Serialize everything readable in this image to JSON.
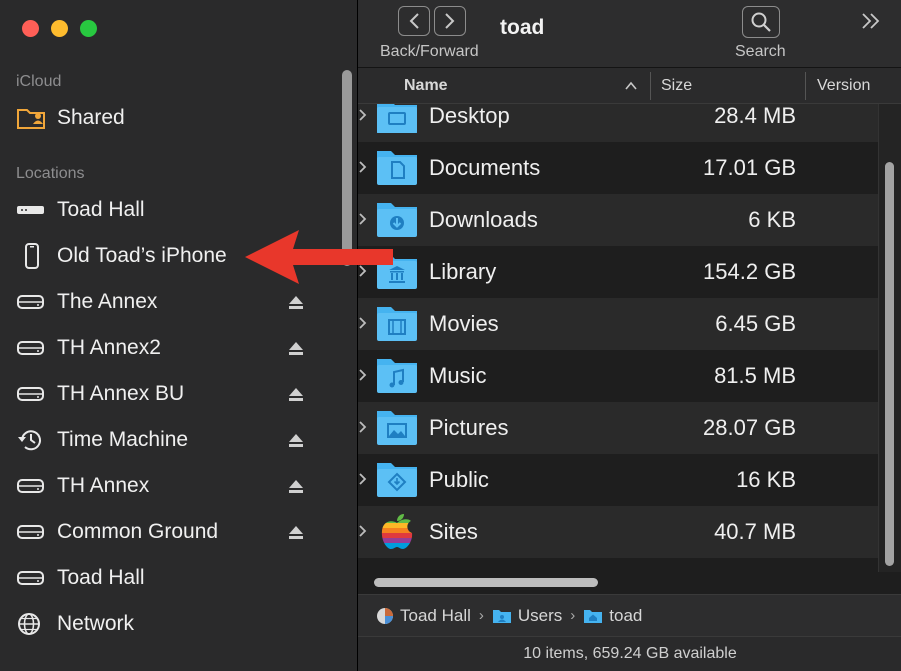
{
  "window": {
    "title": "toad"
  },
  "toolbar": {
    "back_forward_label": "Back/Forward",
    "search_label": "Search"
  },
  "sidebar": {
    "sections": [
      {
        "label": "iCloud",
        "items": [
          {
            "label": "Shared",
            "icon": "shared-folder-icon",
            "eject": false
          }
        ]
      },
      {
        "label": "Locations",
        "items": [
          {
            "label": "Toad Hall",
            "icon": "computer-icon",
            "eject": false
          },
          {
            "label": "Old Toad’s iPhone",
            "icon": "iphone-icon",
            "eject": false
          },
          {
            "label": "The Annex",
            "icon": "drive-icon",
            "eject": true
          },
          {
            "label": "TH Annex2",
            "icon": "drive-icon",
            "eject": true
          },
          {
            "label": "TH Annex BU",
            "icon": "drive-icon",
            "eject": true
          },
          {
            "label": "Time Machine",
            "icon": "time-machine-icon",
            "eject": true
          },
          {
            "label": "TH Annex",
            "icon": "drive-icon",
            "eject": true
          },
          {
            "label": "Common Ground",
            "icon": "drive-icon",
            "eject": true
          },
          {
            "label": "Toad Hall",
            "icon": "drive-icon",
            "eject": false
          },
          {
            "label": "Network",
            "icon": "network-globe-icon",
            "eject": false
          }
        ]
      }
    ]
  },
  "columns": {
    "name": "Name",
    "size": "Size",
    "version": "Version"
  },
  "files": [
    {
      "name": "Desktop",
      "size": "28.4 MB",
      "icon": "desktop-folder-icon"
    },
    {
      "name": "Documents",
      "size": "17.01 GB",
      "icon": "documents-folder-icon"
    },
    {
      "name": "Downloads",
      "size": "6 KB",
      "icon": "downloads-folder-icon"
    },
    {
      "name": "Library",
      "size": "154.2 GB",
      "icon": "library-folder-icon"
    },
    {
      "name": "Movies",
      "size": "6.45 GB",
      "icon": "movies-folder-icon"
    },
    {
      "name": "Music",
      "size": "81.5 MB",
      "icon": "music-folder-icon"
    },
    {
      "name": "Pictures",
      "size": "28.07 GB",
      "icon": "pictures-folder-icon"
    },
    {
      "name": "Public",
      "size": "16 KB",
      "icon": "public-folder-icon"
    },
    {
      "name": "Sites",
      "size": "40.7 MB",
      "icon": "apple-logo-icon"
    }
  ],
  "pathbar": {
    "segments": [
      "Toad Hall",
      "Users",
      "toad"
    ]
  },
  "status": {
    "text": "10 items, 659.24 GB available"
  },
  "colors": {
    "accent_folder": "#45b3f0",
    "arrow": "#e8372b",
    "sidebar_bg": "#2a2a2b"
  }
}
